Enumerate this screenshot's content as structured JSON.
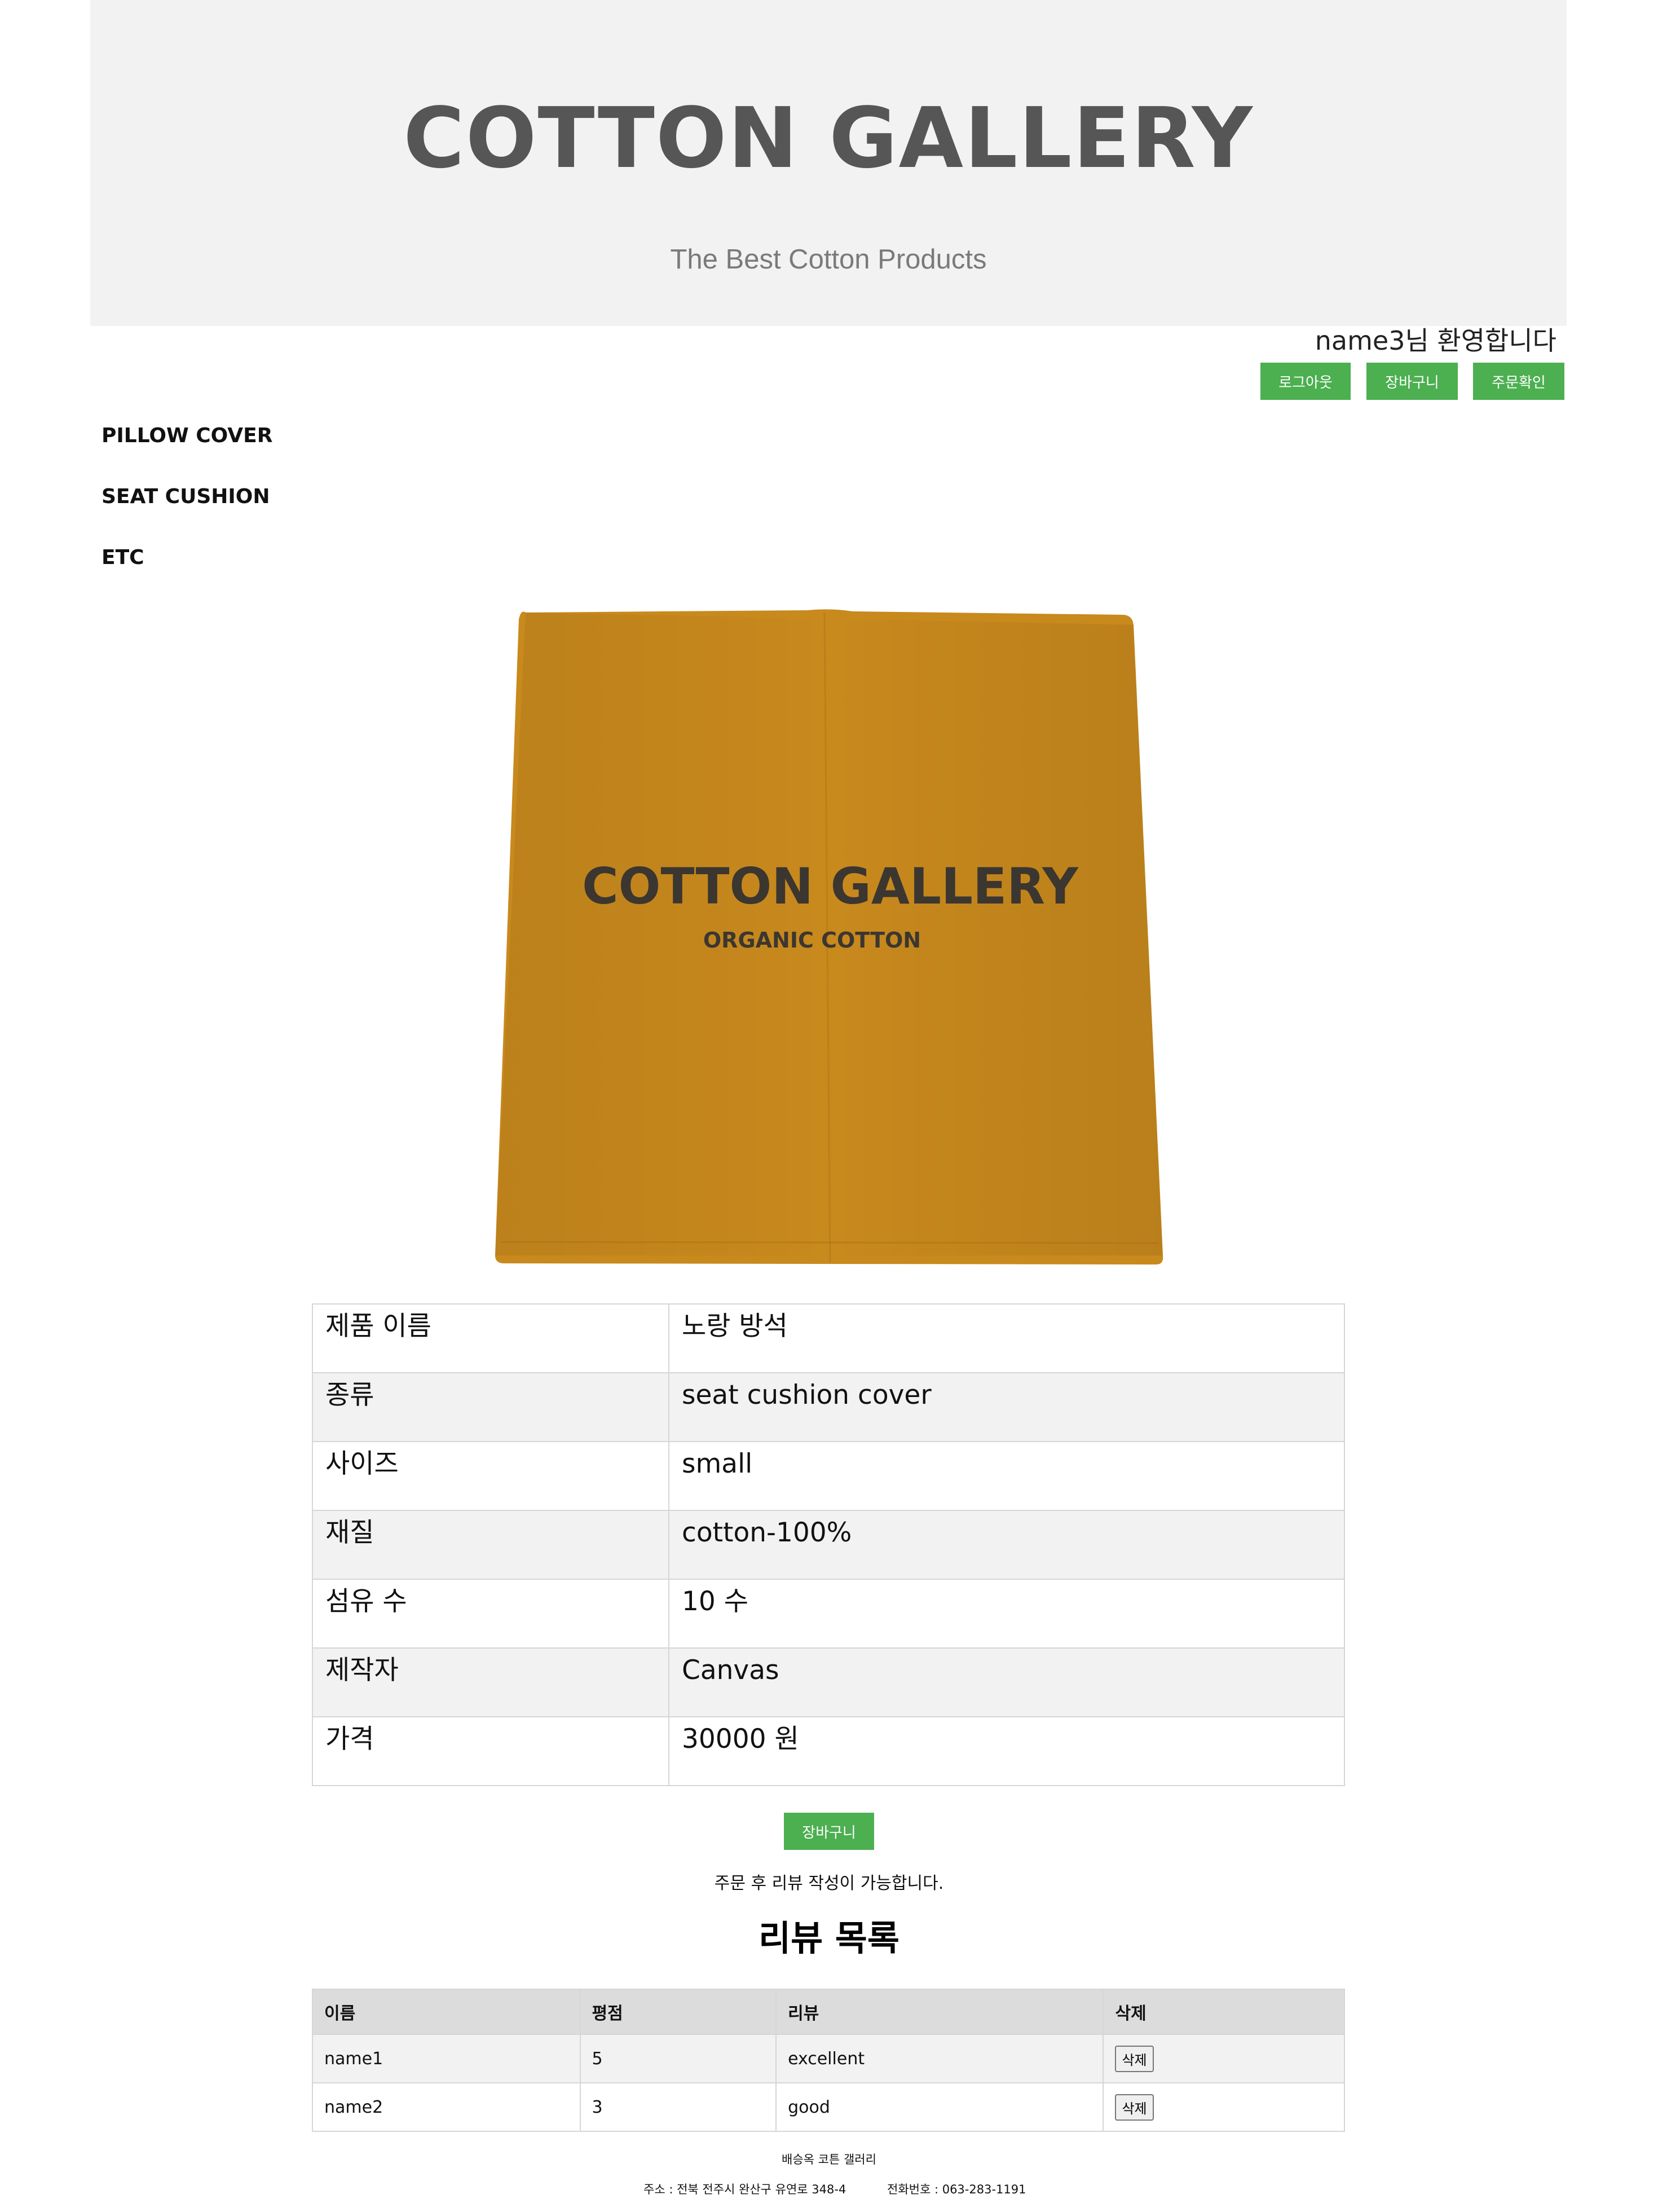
{
  "header": {
    "brand": "COTTON GALLERY",
    "tagline": "The Best Cotton Products"
  },
  "user": {
    "welcome": "name3님 환영합니다",
    "logout_label": "로그아웃",
    "cart_label": "장바구니",
    "orders_label": "주문확인"
  },
  "categories": [
    "PILLOW COVER",
    "SEAT CUSHION",
    "ETC"
  ],
  "product_image": {
    "fabric_color": "#c8891d",
    "print_main": "COTTON GALLERY",
    "print_sub": "ORGANIC COTTON"
  },
  "spec": [
    {
      "label": "제품 이름",
      "value": "노랑 방석"
    },
    {
      "label": "종류",
      "value": "seat cushion cover"
    },
    {
      "label": "사이즈",
      "value": "small"
    },
    {
      "label": "재질",
      "value": "cotton-100%"
    },
    {
      "label": "섬유 수",
      "value": "10 수"
    },
    {
      "label": "제작자",
      "value": "Canvas"
    },
    {
      "label": "가격",
      "value": "30000 원"
    }
  ],
  "add_to_cart_label": "장바구니",
  "review_note": "주문 후 리뷰 작성이 가능합니다.",
  "reviews": {
    "title": "리뷰 목록",
    "columns": [
      "이름",
      "평점",
      "리뷰",
      "삭제"
    ],
    "rows": [
      {
        "name": "name1",
        "rating": "5",
        "text": "excellent",
        "delete_label": "삭제"
      },
      {
        "name": "name2",
        "rating": "3",
        "text": "good",
        "delete_label": "삭제"
      }
    ]
  },
  "footer": {
    "company": "배승옥 코튼 갤러리",
    "address": "주소 : 전북 전주시 완산구 유연로 348-4",
    "phone": "전화번호 : 063-283-1191"
  },
  "colors": {
    "accent_green": "#4caf50",
    "header_bg": "#f2f2f2"
  }
}
